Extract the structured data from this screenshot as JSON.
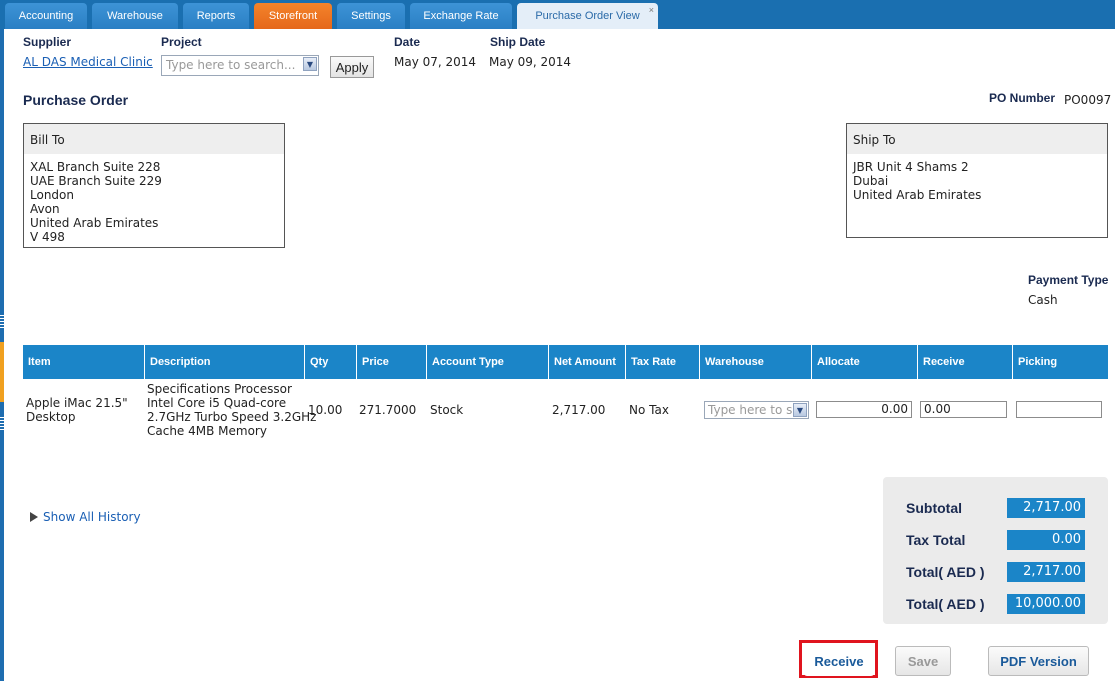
{
  "tabs": [
    {
      "label": "Accounting"
    },
    {
      "label": "Warehouse"
    },
    {
      "label": "Reports"
    },
    {
      "label": "Storefront"
    },
    {
      "label": "Settings"
    },
    {
      "label": "Exchange Rate"
    },
    {
      "label": "Purchase Order View",
      "close": "×"
    }
  ],
  "header": {
    "supplier_label": "Supplier",
    "supplier_value": "AL DAS Medical Clinic",
    "project_label": "Project",
    "project_placeholder": "Type here to search...",
    "apply_label": "Apply",
    "date_label": "Date",
    "date_value": "May 07, 2014",
    "ship_date_label": "Ship Date",
    "ship_date_value": "May 09, 2014"
  },
  "po": {
    "title": "Purchase Order",
    "number_label": "PO Number",
    "number_value": "PO0097"
  },
  "bill_to": {
    "title": "Bill To",
    "address": "XAL Branch Suite 228\nUAE Branch Suite 229\nLondon\nAvon\nUnited Arab Emirates\nV 498"
  },
  "ship_to": {
    "title": "Ship To",
    "address": "JBR Unit 4 Shams 2\nDubai\nUnited Arab Emirates"
  },
  "payment": {
    "label": "Payment Type",
    "value": "Cash"
  },
  "table": {
    "columns": [
      "Item",
      "Description",
      "Qty",
      "Price",
      "Account Type",
      "Net Amount",
      "Tax Rate",
      "Warehouse",
      "Allocate",
      "Receive",
      "Picking"
    ],
    "rows": [
      {
        "item": "Apple iMac 21.5\"\nDesktop",
        "description": "Specifications Processor\nIntel Core i5 Quad-core\n2.7GHz Turbo Speed 3.2GHz\nCache 4MB Memory",
        "qty": "10.00",
        "price": "271.7000",
        "account_type": "Stock",
        "net_amount": "2,717.00",
        "tax_rate": "No Tax",
        "warehouse_placeholder": "Type here to sea",
        "allocate": "0.00",
        "receive": "0.00",
        "picking": ""
      }
    ]
  },
  "history_link": "Show All History",
  "totals": [
    {
      "label": "Subtotal",
      "value": "2,717.00"
    },
    {
      "label": "Tax Total",
      "value": "0.00"
    },
    {
      "label": "Total( AED )",
      "value": "2,717.00"
    },
    {
      "label": "Total( AED )",
      "value": "10,000.00"
    }
  ],
  "buttons": {
    "receive": "Receive",
    "save": "Save",
    "pdf": "PDF Version"
  },
  "colors": {
    "tab_bar": "#1a6fb0",
    "tab_orange": "#e5671a",
    "table_header": "#1b85c8",
    "highlight": "#e0141e"
  }
}
